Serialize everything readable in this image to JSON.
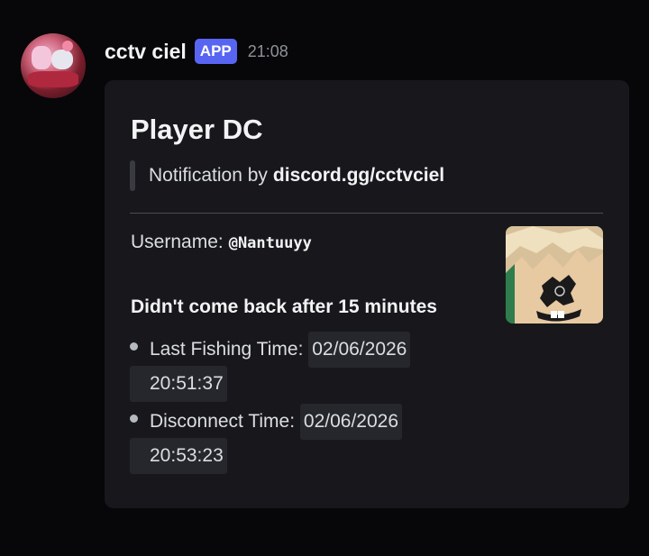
{
  "message": {
    "author": "cctv ciel",
    "badge": "APP",
    "time": "21:08"
  },
  "embed": {
    "title": "Player DC",
    "quote_prefix": "Notification by",
    "quote_link": "discord.gg/cctvciel",
    "username_label": "Username:",
    "username_value": "@Nantuuyy",
    "heading": "Didn't come back after 15 minutes",
    "items": [
      {
        "label": "Last Fishing Time:",
        "date": "02/06/2026",
        "time": "20:51:37"
      },
      {
        "label": "Disconnect Time:",
        "date": "02/06/2026",
        "time": "20:53:23"
      }
    ]
  },
  "colors": {
    "background": "#070709",
    "embed_background": "#18181c",
    "app_badge": "#5865f2"
  },
  "icons": {
    "avatar": "bot-avatar",
    "thumbnail": "roblox-avatar-thumbnail"
  }
}
